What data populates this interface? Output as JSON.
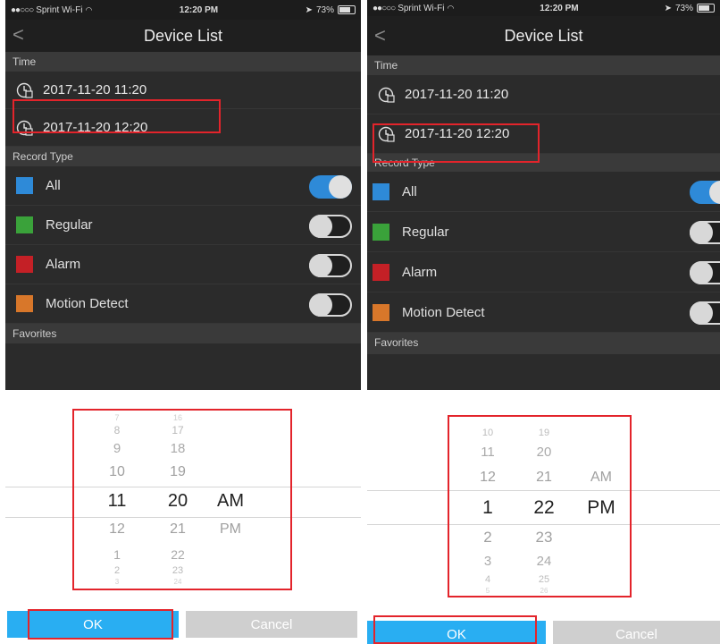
{
  "status": {
    "carrier": "Sprint Wi-Fi",
    "time": "12:20 PM",
    "battery": "73%"
  },
  "nav": {
    "title": "Device List",
    "back_glyph": "<"
  },
  "sections": {
    "time": "Time",
    "record_type": "Record Type",
    "favorites": "Favorites"
  },
  "times": [
    "2017-11-20 11:20",
    "2017-11-20 12:20"
  ],
  "record_types": [
    {
      "label": "All",
      "color": "#2e8ad8"
    },
    {
      "label": "Regular",
      "color": "#3aa23a"
    },
    {
      "label": "Alarm",
      "color": "#c42026"
    },
    {
      "label": "Motion Detect",
      "color": "#d8772a"
    }
  ],
  "screens": [
    {
      "toggles": [
        true,
        false,
        false,
        false
      ],
      "picker": {
        "hours": [
          "7",
          "8",
          "9",
          "10",
          "11",
          "12",
          "1",
          "2",
          "3"
        ],
        "minutes": [
          "16",
          "17",
          "18",
          "19",
          "20",
          "21",
          "22",
          "23",
          "24"
        ],
        "periods": [
          "AM",
          "PM"
        ]
      },
      "buttons": {
        "ok": "OK",
        "cancel": "Cancel"
      }
    },
    {
      "toggles": [
        true,
        false,
        false,
        false
      ],
      "picker": {
        "hours": [
          "10",
          "11",
          "12",
          "1",
          "2",
          "3",
          "4",
          "5"
        ],
        "minutes": [
          "19",
          "20",
          "21",
          "22",
          "23",
          "24",
          "25",
          "26"
        ],
        "periods": [
          "AM",
          "PM"
        ]
      },
      "buttons": {
        "ok": "OK",
        "cancel": "Cancel"
      }
    }
  ],
  "colors": {
    "accent_blue": "#29aef2",
    "highlight_red": "#e3242b",
    "dark_bg": "#2b2b2b"
  }
}
